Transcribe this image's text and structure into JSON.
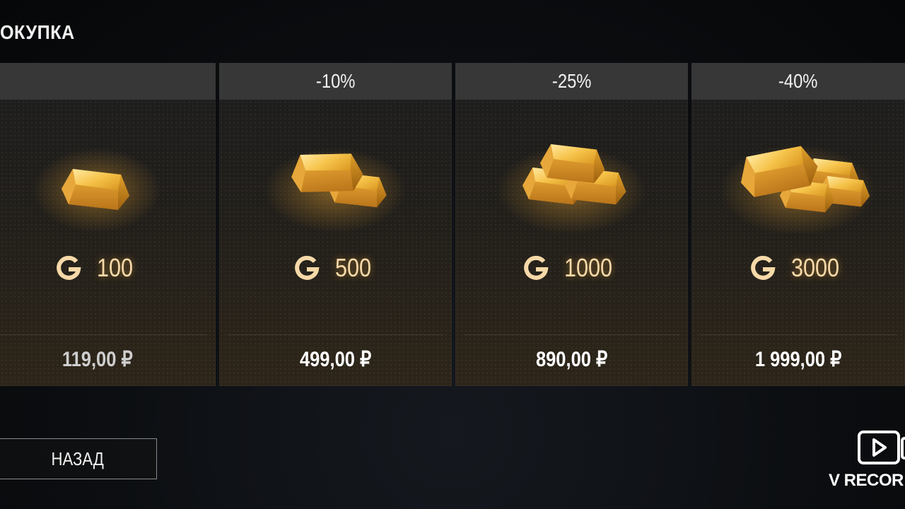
{
  "header": {
    "title": "ОКУПКА"
  },
  "colors": {
    "gold": "#f2b233",
    "card_header_bg": "#373737",
    "background": "#0b0d10"
  },
  "cards": [
    {
      "discount": "",
      "gold_amount": "100",
      "price": "119,00 ₽",
      "icon": "gold-bar-icon"
    },
    {
      "discount": "-10%",
      "gold_amount": "500",
      "price": "499,00 ₽",
      "icon": "gold-bars-pair-icon"
    },
    {
      "discount": "-25%",
      "gold_amount": "1000",
      "price": "890,00 ₽",
      "icon": "gold-bars-stack-icon"
    },
    {
      "discount": "-40%",
      "gold_amount": "3000",
      "price": "1 999,00 ₽",
      "icon": "gold-bars-pile-icon"
    }
  ],
  "currency_icon": "g-currency-icon",
  "footer": {
    "back_label": "НАЗАД"
  },
  "watermark": {
    "text": "V RECOR",
    "icon": "video-recorder-icon"
  }
}
